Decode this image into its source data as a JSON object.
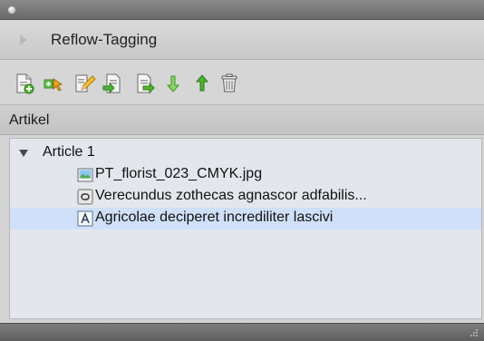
{
  "panel": {
    "title": "Reflow-Tagging"
  },
  "toolbar": {
    "buttons": [
      {
        "name": "new-document-icon"
      },
      {
        "name": "add-tag-icon"
      },
      {
        "name": "edit-icon"
      },
      {
        "name": "import-icon"
      },
      {
        "name": "export-icon"
      },
      {
        "name": "move-down-icon"
      },
      {
        "name": "move-up-icon"
      },
      {
        "name": "trash-icon"
      }
    ]
  },
  "section": {
    "label": "Artikel"
  },
  "tree": {
    "items": [
      {
        "label": "Article 1",
        "type": "article",
        "expanded": true
      },
      {
        "label": "PT_florist_023_CMYK.jpg",
        "type": "image",
        "icon": "image-file-icon"
      },
      {
        "label": "Verecundus zothecas agnascor adfabilis...",
        "type": "linked-text",
        "icon": "linked-text-icon"
      },
      {
        "label": "Agricolae deciperet incrediliter lascivi",
        "type": "text",
        "icon": "text-frame-icon",
        "selected": true
      }
    ]
  },
  "colors": {
    "selection": "#cfe0f8",
    "tree_background": "#e3e7ed",
    "arrow_green": "#4bb52e"
  }
}
